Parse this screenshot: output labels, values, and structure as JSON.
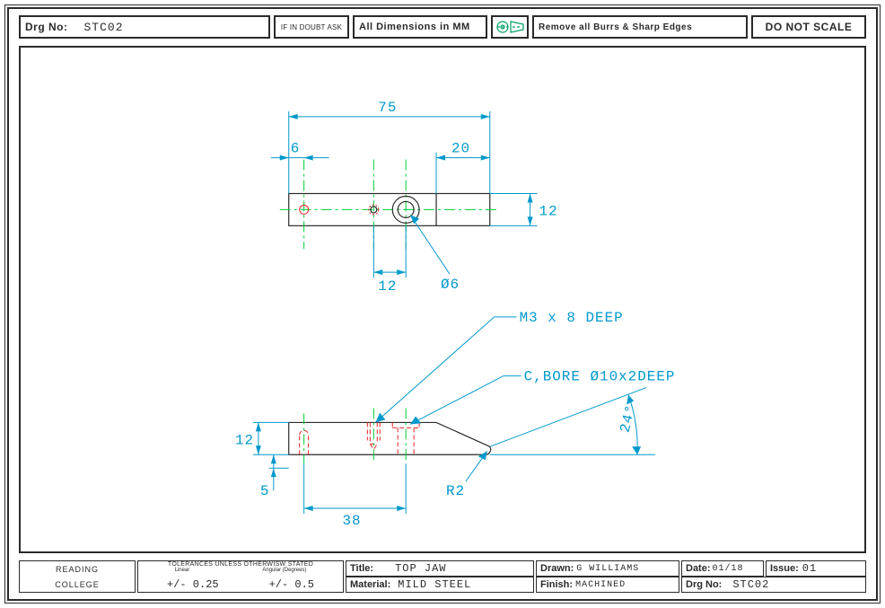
{
  "header": {
    "drg_no_label": "Drg No:",
    "drg_no": "STC02",
    "doubt": "IF IN DOUBT ASK",
    "units": "All Dimensions in MM",
    "burrs": "Remove all Burrs & Sharp Edges",
    "noscale": "DO NOT SCALE"
  },
  "footer": {
    "org_line1": "READING",
    "org_line2": "COLLEGE",
    "tol_head": "TOLERANCES UNLESS OTHERWISW STATED",
    "tol_lin_label": "Linear",
    "tol_ang_label": "Angular (Degrees)",
    "tol_lin": "+/- 0.25",
    "tol_ang": "+/- 0.5",
    "title_label": "Title:",
    "title": "TOP JAW",
    "material_label": "Material:",
    "material": "MILD STEEL",
    "finish_label": "Finish:",
    "finish": "MACHINED",
    "drawn_label": "Drawn:",
    "drawn": "G WILLIAMS",
    "drgno_label": "Drg No:",
    "drgno": "STC02",
    "date_label": "Date:",
    "date": "01/18",
    "issue_label": "Issue:",
    "issue": "01"
  },
  "dims": {
    "d75": "75",
    "d6": "6",
    "d20": "20",
    "d12a": "12",
    "d12b": "12",
    "d12c": "12",
    "d5": "5",
    "d38": "38",
    "dia6": "Ø6",
    "r2": "R2",
    "ang24": "24°",
    "m3": "M3 x 8 DEEP",
    "cbore": "C,BORE Ø10x2DEEP"
  }
}
